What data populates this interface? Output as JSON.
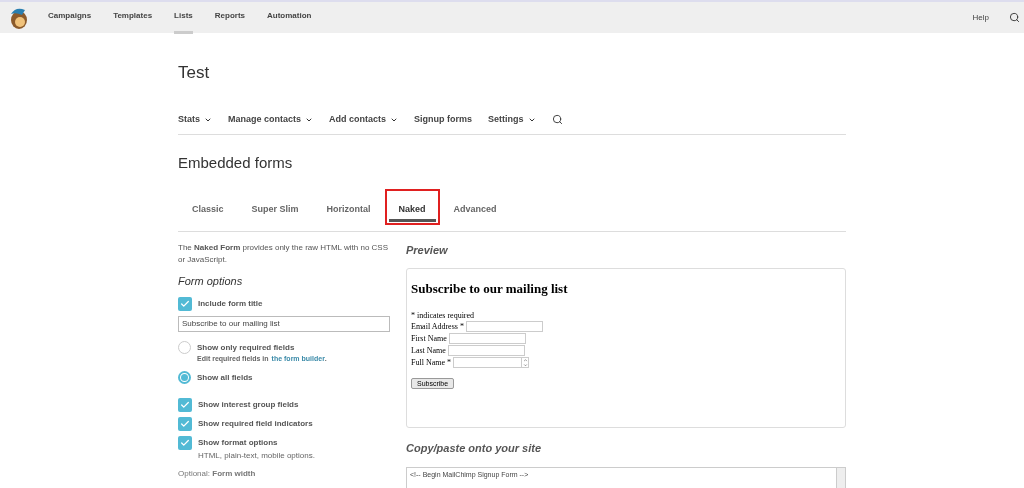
{
  "topnav": {
    "items": [
      {
        "label": "Campaigns",
        "selected": false
      },
      {
        "label": "Templates",
        "selected": false
      },
      {
        "label": "Lists",
        "selected": true
      },
      {
        "label": "Reports",
        "selected": false
      },
      {
        "label": "Automation",
        "selected": false
      }
    ],
    "help": "Help"
  },
  "page_title": "Test",
  "subnav": [
    {
      "label": "Stats",
      "has_menu": true
    },
    {
      "label": "Manage contacts",
      "has_menu": true
    },
    {
      "label": "Add contacts",
      "has_menu": true
    },
    {
      "label": "Signup forms",
      "has_menu": false
    },
    {
      "label": "Settings",
      "has_menu": true
    }
  ],
  "section_title": "Embedded forms",
  "tabs": [
    {
      "label": "Classic",
      "selected": false,
      "highlighted": false
    },
    {
      "label": "Super Slim",
      "selected": false,
      "highlighted": false
    },
    {
      "label": "Horizontal",
      "selected": false,
      "highlighted": false
    },
    {
      "label": "Naked",
      "selected": true,
      "highlighted": true
    },
    {
      "label": "Advanced",
      "selected": false,
      "highlighted": false
    }
  ],
  "description": "The **Naked Form** provides only the raw HTML with no CSS or JavaScript.",
  "form_options": {
    "title": "Form options",
    "include_title": {
      "label": "Include form title",
      "checked": true,
      "value": "Subscribe to our mailing list"
    },
    "radios": [
      {
        "label": "Show only required fields",
        "selected": false,
        "hint": "Edit required fields in",
        "link": "the form builder",
        "hint_end": "."
      },
      {
        "label": "Show all fields",
        "selected": true
      }
    ],
    "checkboxes": [
      {
        "label": "Show interest group fields",
        "checked": true
      },
      {
        "label": "Show required field indicators",
        "checked": true
      },
      {
        "label": "Show format options",
        "checked": true,
        "hint": "HTML, plain-text, mobile options."
      }
    ],
    "optional": "Optional: **Form width**"
  },
  "preview": {
    "title": "Preview",
    "form_title": "Subscribe to our mailing list",
    "required_note": "* indicates required",
    "fields": [
      {
        "label": "Email Address *",
        "kind": "text"
      },
      {
        "label": "First Name",
        "kind": "text"
      },
      {
        "label": "Last Name",
        "kind": "text"
      },
      {
        "label": "Full Name *",
        "kind": "spinner"
      }
    ],
    "button": "Subscribe"
  },
  "copy": {
    "title": "Copy/paste onto your site",
    "code": "<!-- Begin MailChimp Signup Form -->"
  }
}
